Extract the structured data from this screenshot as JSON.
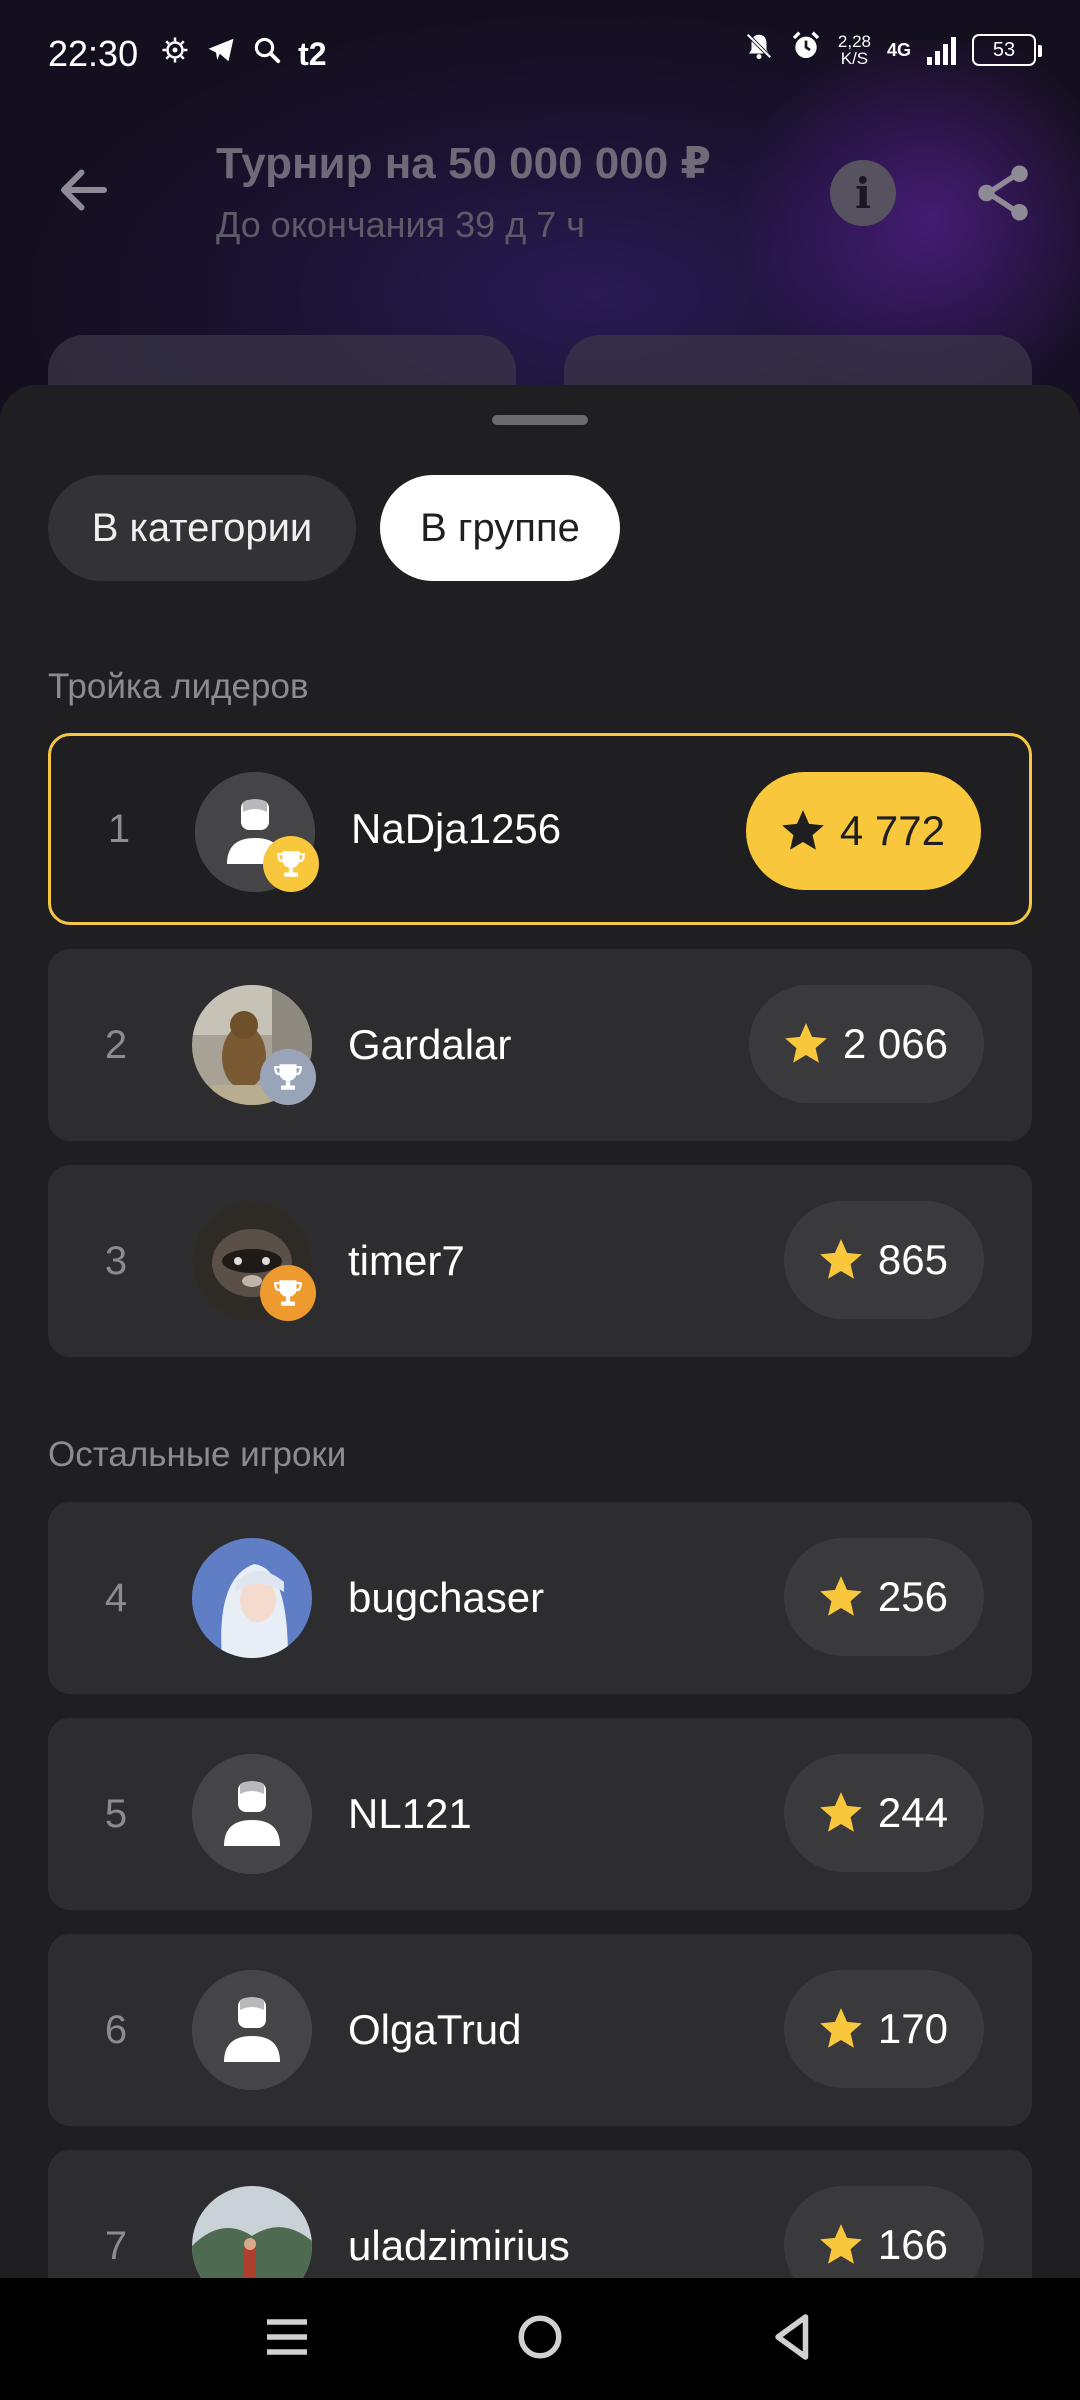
{
  "status_bar": {
    "time": "22:30",
    "left_icons": [
      "settings-icon",
      "telegram-icon",
      "search-icon",
      "t2-icon"
    ],
    "carrier_label": "t2",
    "speed_value": "2,28",
    "speed_unit": "K/S",
    "network": "4G",
    "battery": "53"
  },
  "header": {
    "title": "Турнир на 50 000 000 ₽",
    "subtitle": "До окончания 39 д 7 ч",
    "info_label": "i"
  },
  "tabs": [
    {
      "label": "В категории",
      "selected": false
    },
    {
      "label": "В группе",
      "selected": true
    }
  ],
  "sections": {
    "leaders_title": "Тройка лидеров",
    "others_title": "Остальные игроки"
  },
  "players": [
    {
      "rank": "1",
      "name": "NaDja1256",
      "score": "4 772",
      "avatar": "default-avatar-icon",
      "trophy": "gold"
    },
    {
      "rank": "2",
      "name": "Gardalar",
      "score": "2 066",
      "avatar": "marmot-photo",
      "trophy": "silver"
    },
    {
      "rank": "3",
      "name": "timer7",
      "score": "865",
      "avatar": "raccoon-photo",
      "trophy": "bronze"
    },
    {
      "rank": "4",
      "name": "bugchaser",
      "score": "256",
      "avatar": "anime-girl-photo"
    },
    {
      "rank": "5",
      "name": "NL121",
      "score": "244",
      "avatar": "default-avatar-icon"
    },
    {
      "rank": "6",
      "name": "OlgaTrud",
      "score": "170",
      "avatar": "default-avatar-icon"
    },
    {
      "rank": "7",
      "name": "uladzimirius",
      "score": "166",
      "avatar": "landscape-photo"
    }
  ],
  "colors": {
    "gold": "#f8c73b",
    "silver": "#9aa4b8",
    "bronze": "#ee9a2e",
    "sheet_bg": "#1f1f21",
    "row_bg": "#2d2d30"
  }
}
